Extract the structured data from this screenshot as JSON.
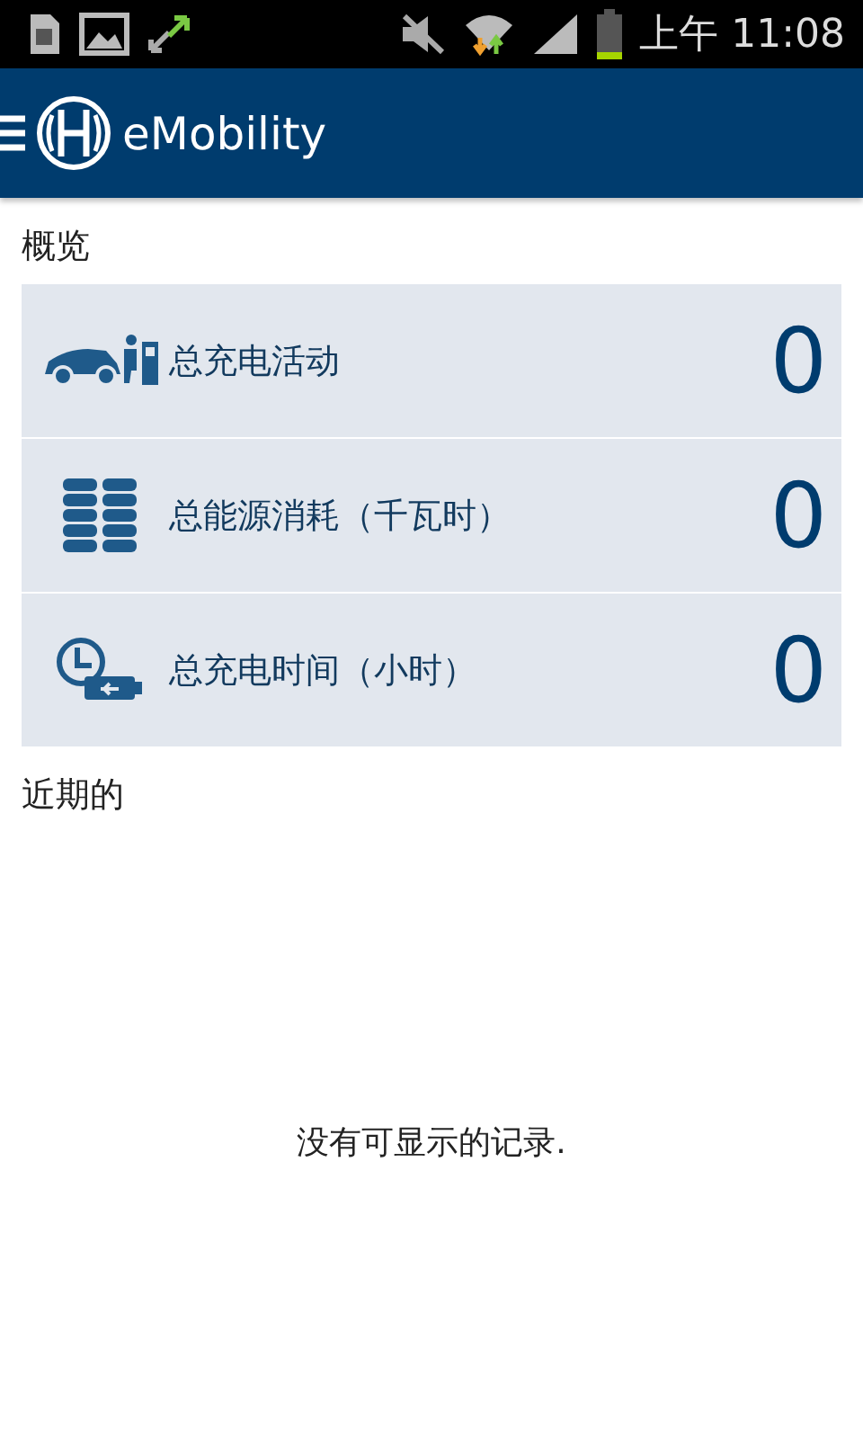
{
  "status_bar": {
    "time": "上午 11:08"
  },
  "app_bar": {
    "title": "eMobility"
  },
  "overview": {
    "heading": "概览",
    "stats": [
      {
        "kind": "charging",
        "label": "总充电活动",
        "value": "0"
      },
      {
        "kind": "energy",
        "label": "总能源消耗（千瓦时）",
        "value": "0"
      },
      {
        "kind": "time",
        "label": "总充电时间（小时）",
        "value": "0"
      }
    ]
  },
  "recent": {
    "heading": "近期的",
    "empty_message": "没有可显示的记录."
  }
}
